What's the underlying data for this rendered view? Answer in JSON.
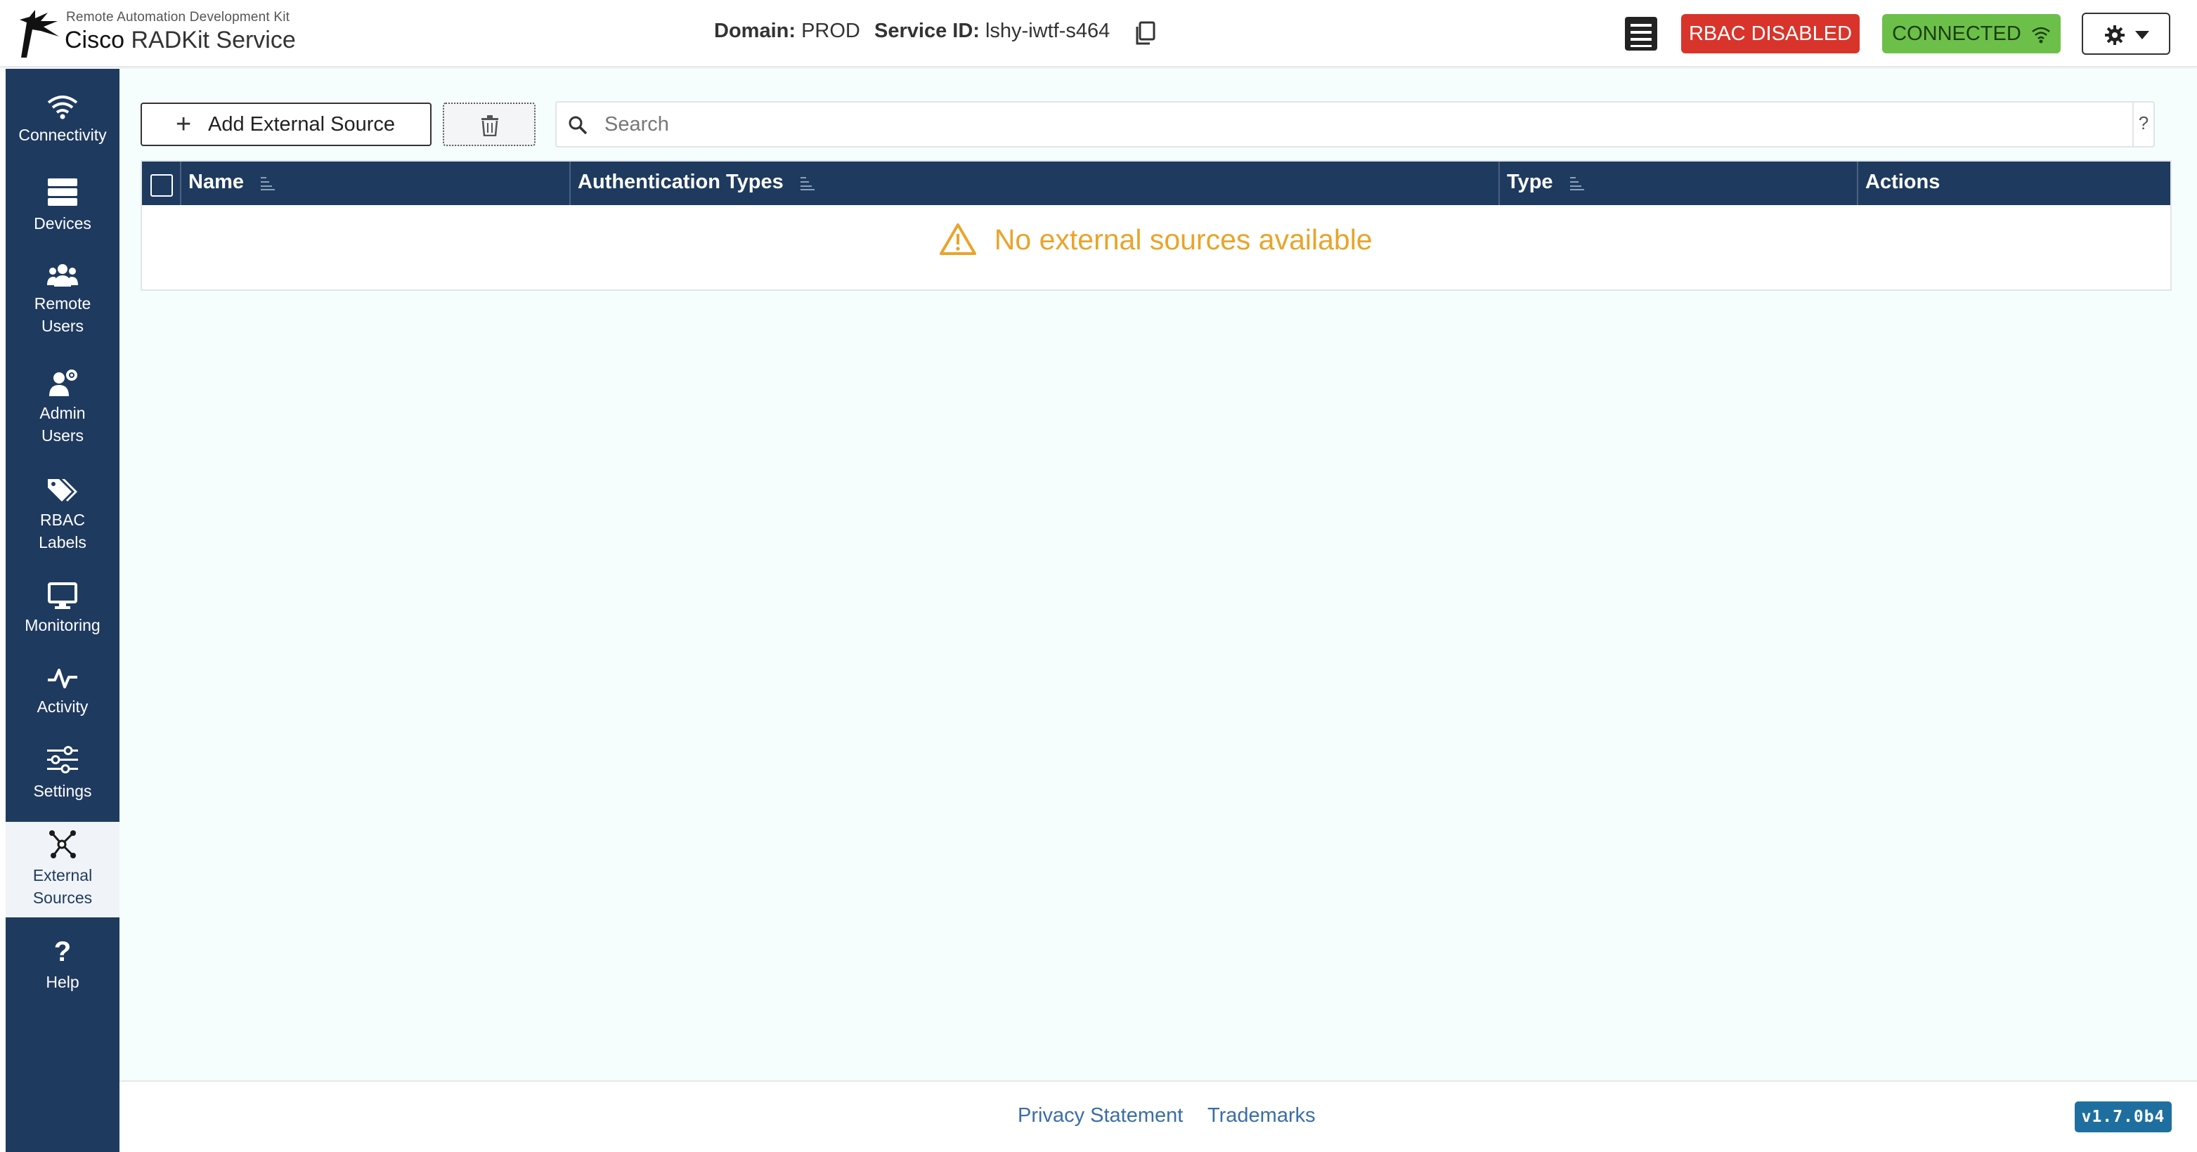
{
  "brand": {
    "subtitle": "Remote Automation Development Kit",
    "title_bold": "Cisco",
    "title_light": "RADKit Service"
  },
  "header": {
    "domain_label": "Domain:",
    "domain_value": "PROD",
    "service_label": "Service ID:",
    "service_value": "lshy-iwtf-s464",
    "rbac_status": "RBAC DISABLED",
    "connection_status": "CONNECTED"
  },
  "sidebar": {
    "items": [
      {
        "label": "Connectivity",
        "icon": "wifi-icon"
      },
      {
        "label": "Devices",
        "icon": "server-icon"
      },
      {
        "label_line1": "Remote",
        "label_line2": "Users",
        "icon": "users-icon"
      },
      {
        "label_line1": "Admin",
        "label_line2": "Users",
        "icon": "admin-user-icon"
      },
      {
        "label_line1": "RBAC",
        "label_line2": "Labels",
        "icon": "tags-icon"
      },
      {
        "label": "Monitoring",
        "icon": "monitor-icon"
      },
      {
        "label": "Activity",
        "icon": "pulse-icon"
      },
      {
        "label": "Settings",
        "icon": "sliders-icon"
      },
      {
        "label_line1": "External",
        "label_line2": "Sources",
        "icon": "network-icon",
        "active": true
      },
      {
        "label": "Help",
        "icon": "question-icon"
      }
    ]
  },
  "toolbar": {
    "add_label": "Add External Source",
    "search_placeholder": "Search",
    "search_help": "?"
  },
  "table": {
    "columns": [
      "Name",
      "Authentication Types",
      "Type",
      "Actions"
    ],
    "empty_message": "No external sources available"
  },
  "footer": {
    "privacy": "Privacy Statement",
    "trademarks": "Trademarks",
    "version": "v1.7.0b4"
  },
  "colors": {
    "sidebar_bg": "#1f3a5f",
    "rbac_bg": "#d9342b",
    "connected_bg": "#6cc04a",
    "warning": "#e9a42a",
    "link": "#3a6ea5",
    "version_bg": "#1e6f9f"
  }
}
